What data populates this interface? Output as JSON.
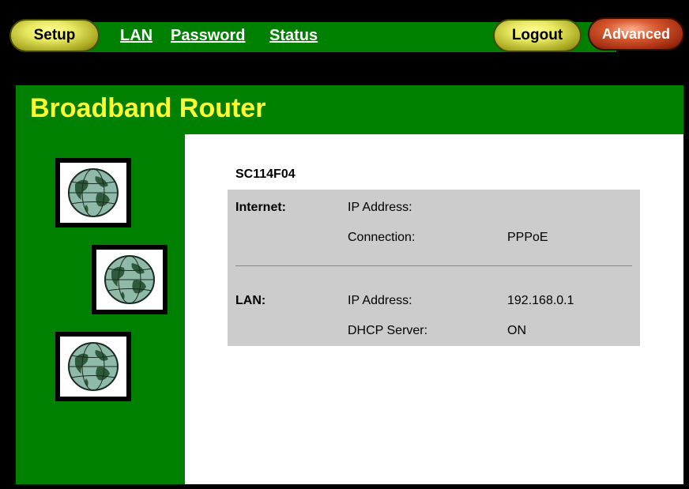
{
  "nav": {
    "setup_label": "Setup",
    "links": [
      "LAN",
      "Password",
      "Status"
    ],
    "logout_label": "Logout",
    "advanced_label": "Advanced"
  },
  "page": {
    "title": "Broadband Router",
    "device_name": "SC114F04"
  },
  "status": {
    "internet": {
      "label": "Internet",
      "rows": [
        {
          "field": "IP Address:",
          "value": ""
        },
        {
          "field": "Connection:",
          "value": "PPPoE"
        }
      ]
    },
    "lan": {
      "label": "LAN",
      "rows": [
        {
          "field": "IP Address:",
          "value": "192.168.0.1"
        },
        {
          "field": "DHCP Server:",
          "value": "ON"
        }
      ]
    }
  },
  "colors": {
    "brand_green": "#008000",
    "title_yellow": "#ffff33",
    "status_box": "#cccccc"
  },
  "icons": [
    "globe-icon",
    "globe-icon",
    "globe-icon"
  ]
}
